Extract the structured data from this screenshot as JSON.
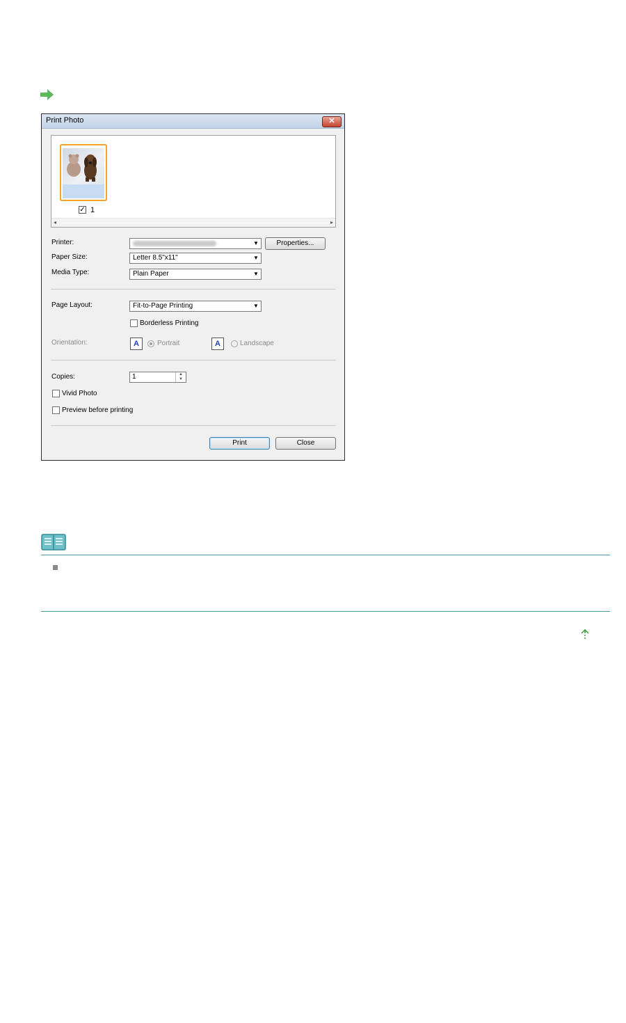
{
  "colors": {
    "accent_green": "#5cb85c",
    "thumb_border": "#f5a623",
    "rule": "#4a9aa6",
    "orient_glyph": "#1e3fbf"
  },
  "icons": [
    "arrow-right-icon",
    "close-icon",
    "note-book-icon",
    "bullet-icon",
    "page-top-icon"
  ],
  "dialog": {
    "title": "Print Photo",
    "close_glyph": "✕",
    "thumbnail": {
      "checked": true,
      "number": "1",
      "check_glyph": "✓"
    },
    "scroll": {
      "left_glyph": "◂",
      "right_glyph": "▸"
    },
    "labels": {
      "printer": "Printer:",
      "paper_size": "Paper Size:",
      "media_type": "Media Type:",
      "page_layout": "Page Layout:",
      "orientation": "Orientation:",
      "copies": "Copies:"
    },
    "paper_size_value": "Letter 8.5\"x11\"",
    "media_type_value": "Plain Paper",
    "page_layout_value": "Fit-to-Page Printing",
    "combo_arrow": "▼",
    "properties_button": "Properties...",
    "borderless_label": "Borderless Printing",
    "orientation_glyph": "A",
    "portrait_label": "Portrait",
    "landscape_label": "Landscape",
    "copies_value": "1",
    "spin_up": "▲",
    "spin_down": "▼",
    "vivid_photo_label": "Vivid Photo",
    "preview_label": "Preview before printing",
    "print_button": "Print",
    "close_button": "Close"
  }
}
